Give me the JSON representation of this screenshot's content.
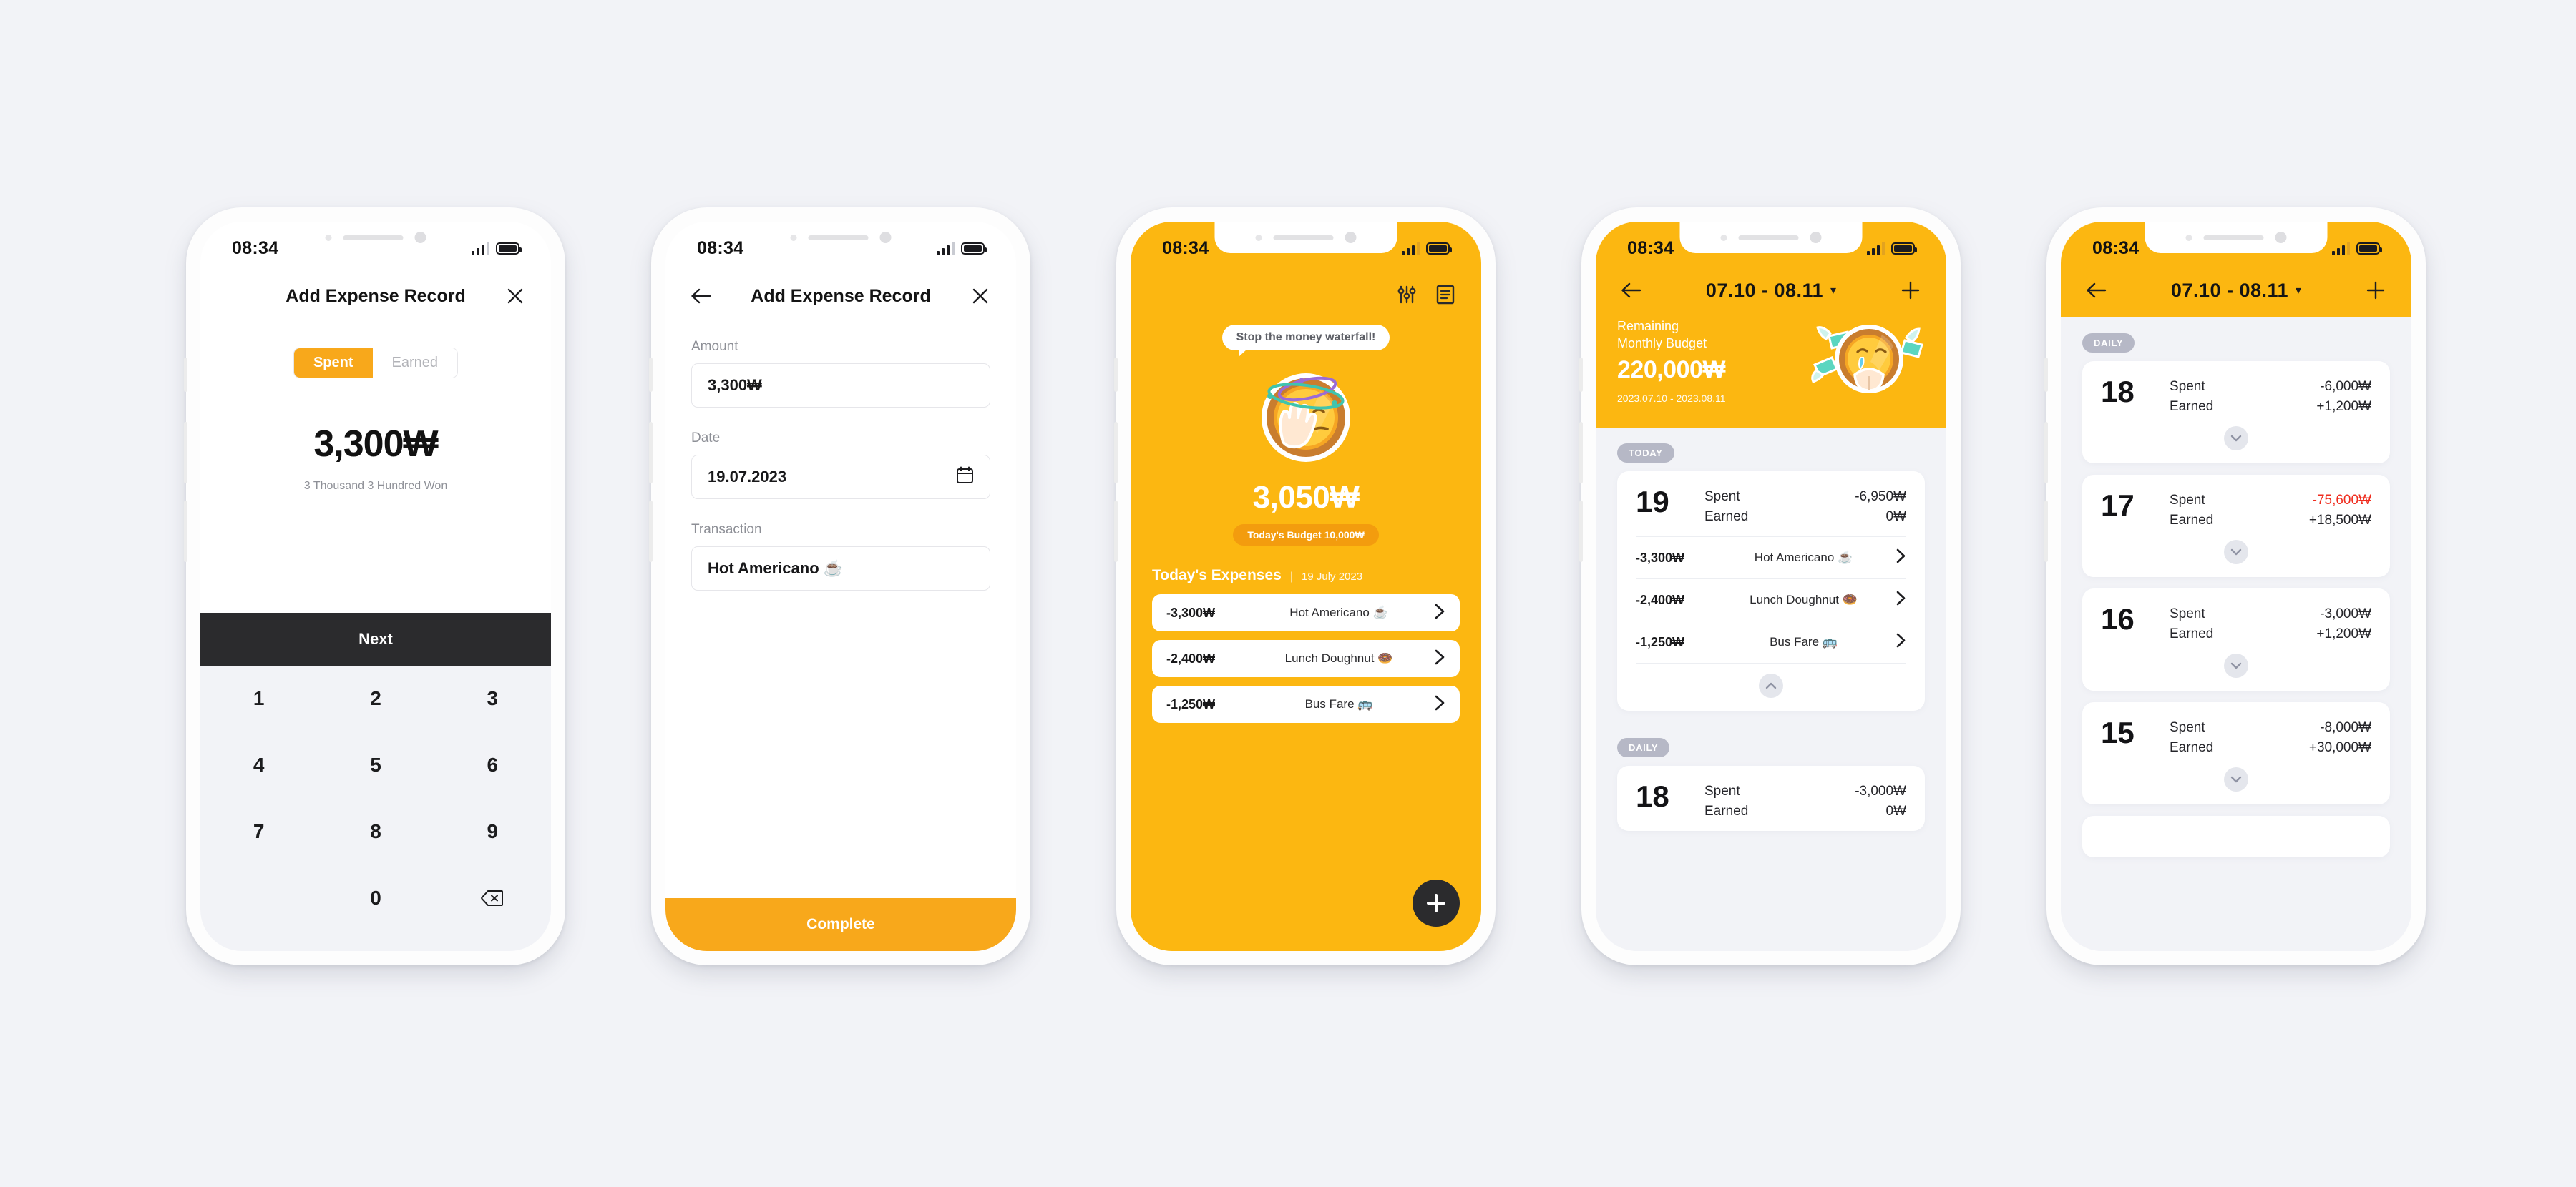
{
  "common": {
    "status_time": "08:34",
    "currency": "₩"
  },
  "screen1": {
    "title": "Add Expense Record",
    "close_icon": "close-icon",
    "toggle": {
      "spent": "Spent",
      "earned": "Earned",
      "active": "Spent"
    },
    "amount": "3,300₩",
    "amount_words": "3 Thousand 3 Hundred Won",
    "next_label": "Next",
    "keys": [
      "1",
      "2",
      "3",
      "4",
      "5",
      "6",
      "7",
      "8",
      "9",
      "",
      "0",
      "backspace"
    ]
  },
  "screen2": {
    "title": "Add Expense Record",
    "back_icon": "arrow-left-icon",
    "close_icon": "close-icon",
    "fields": [
      {
        "label": "Amount",
        "value": "3,300₩",
        "icon": ""
      },
      {
        "label": "Date",
        "value": "19.07.2023",
        "icon": "calendar-icon"
      },
      {
        "label": "Transaction",
        "value": "Hot Americano ☕",
        "icon": ""
      }
    ],
    "complete_label": "Complete"
  },
  "screen3": {
    "filter_icon": "sliders-icon",
    "list_icon": "document-icon",
    "bubble": "Stop the money waterfall!",
    "amount": "3,050₩",
    "budget_badge": "Today's Budget 10,000₩",
    "section_title": "Today's Expenses",
    "section_divider": "|",
    "section_date": "19 July 2023",
    "expenses": [
      {
        "amount": "-3,300₩",
        "name": "Hot Americano ☕"
      },
      {
        "amount": "-2,400₩",
        "name": "Lunch Doughnut 🍩"
      },
      {
        "amount": "-1,250₩",
        "name": "Bus Fare 🚌"
      }
    ],
    "fab_icon": "plus-icon"
  },
  "screen4": {
    "back_icon": "arrow-left-icon",
    "range_title": "07.10 - 08.11",
    "range_caret": "▾",
    "add_icon": "plus-icon",
    "budget_label_line1": "Remaining",
    "budget_label_line2": "Monthly Budget",
    "budget_amount": "220,000₩",
    "budget_range": "2023.07.10 - 2023.08.11",
    "pill_today": "TODAY",
    "pill_daily": "DAILY",
    "day_today": {
      "day": "19",
      "spent_label": "Spent",
      "spent_value": "-6,950₩",
      "earned_label": "Earned",
      "earned_value": "0₩",
      "transactions": [
        {
          "amount": "-3,300₩",
          "name": "Hot Americano ☕"
        },
        {
          "amount": "-2,400₩",
          "name": "Lunch Doughnut 🍩"
        },
        {
          "amount": "-1,250₩",
          "name": "Bus Fare 🚌"
        }
      ],
      "collapse_icon": "chevron-up-icon"
    },
    "day_next": {
      "day": "18",
      "spent_label": "Spent",
      "spent_value": "-3,000₩",
      "earned_label": "Earned",
      "earned_value": "0₩"
    }
  },
  "screen5": {
    "back_icon": "arrow-left-icon",
    "range_title": "07.10 - 08.11",
    "range_caret": "▾",
    "add_icon": "plus-icon",
    "pill_daily": "DAILY",
    "days": [
      {
        "day": "18",
        "spent_label": "Spent",
        "spent_value": "-6,000₩",
        "spent_red": false,
        "earned_label": "Earned",
        "earned_value": "+1,200₩",
        "expand_icon": "chevron-down-icon"
      },
      {
        "day": "17",
        "spent_label": "Spent",
        "spent_value": "-75,600₩",
        "spent_red": true,
        "earned_label": "Earned",
        "earned_value": "+18,500₩",
        "expand_icon": "chevron-down-icon"
      },
      {
        "day": "16",
        "spent_label": "Spent",
        "spent_value": "-3,000₩",
        "spent_red": false,
        "earned_label": "Earned",
        "earned_value": "+1,200₩",
        "expand_icon": "chevron-down-icon"
      },
      {
        "day": "15",
        "spent_label": "Spent",
        "spent_value": "-8,000₩",
        "spent_red": false,
        "earned_label": "Earned",
        "earned_value": "+30,000₩",
        "expand_icon": "chevron-down-icon"
      }
    ]
  },
  "colors": {
    "brand_yellow": "#FCB711",
    "accent_orange": "#F8A81B",
    "dark": "#2b2b2d",
    "page_bg": "#f2f3f7",
    "negative_red": "#ef2d1f",
    "pill_grey": "#b6b8c6"
  }
}
